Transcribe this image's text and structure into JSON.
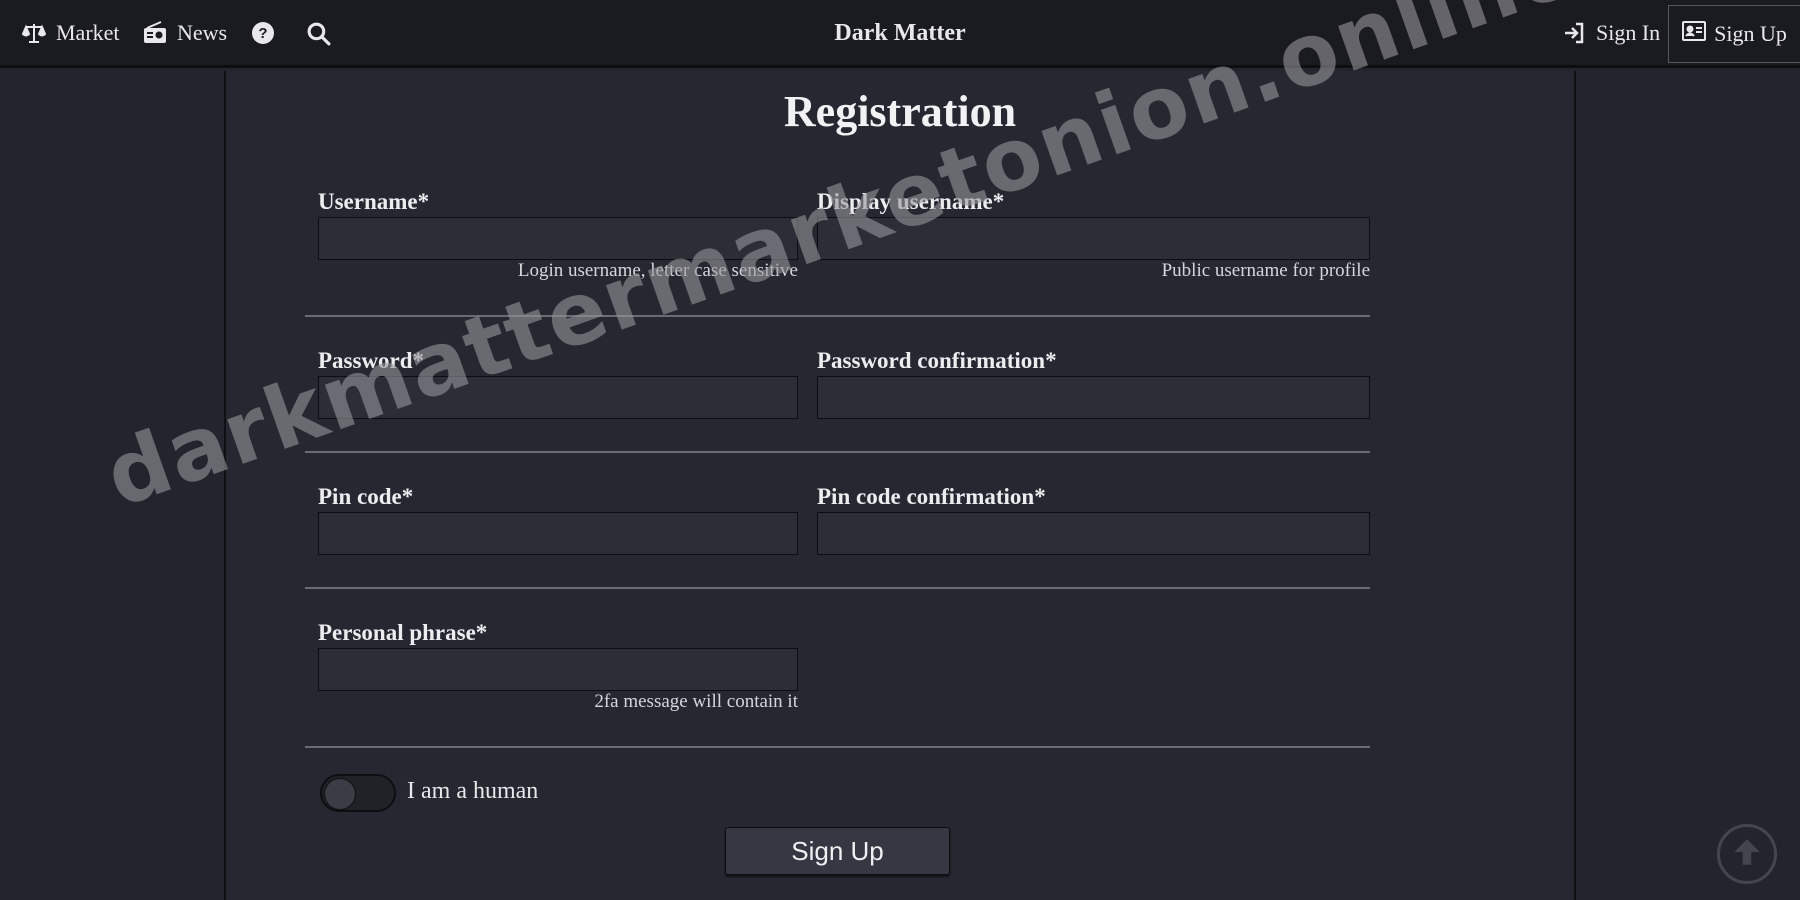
{
  "nav": {
    "market_label": "Market",
    "news_label": "News",
    "brand": "Dark Matter",
    "signin_label": "Sign In",
    "signup_label": "Sign Up",
    "icons": [
      "scales-icon",
      "radio-icon",
      "help-icon",
      "search-icon",
      "sign-in-icon",
      "id-card-icon"
    ]
  },
  "page": {
    "title": "Registration"
  },
  "form": {
    "username": {
      "label": "Username*",
      "value": "",
      "hint": "Login username, letter case sensitive"
    },
    "display_username": {
      "label": "Display username*",
      "value": "",
      "hint": "Public username for profile"
    },
    "password": {
      "label": "Password*",
      "value": ""
    },
    "password_confirmation": {
      "label": "Password confirmation*",
      "value": ""
    },
    "pin": {
      "label": "Pin code*",
      "value": ""
    },
    "pin_confirmation": {
      "label": "Pin code confirmation*",
      "value": ""
    },
    "phrase": {
      "label": "Personal phrase*",
      "value": "",
      "hint": "2fa message will contain it"
    },
    "human_toggle_label": "I am a human",
    "human_toggle_on": false,
    "submit_label": "Sign Up"
  },
  "watermark": "darkmattermarketonion.online",
  "colors": {
    "background": "#23252e",
    "navbar": "#1a1b21",
    "panel": "#262831",
    "input": "#2c2e37",
    "text": "#e8e8ea"
  }
}
